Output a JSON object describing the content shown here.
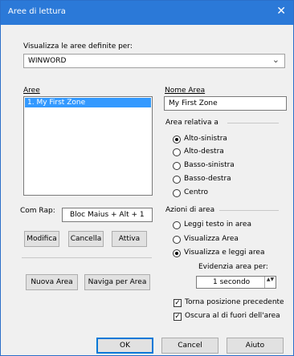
{
  "window": {
    "title": "Aree di lettura",
    "close_glyph": "✕"
  },
  "define_for": {
    "label": "Visualizza le aree definite per:",
    "value": "WINWORD",
    "chevron": "⌄"
  },
  "areas": {
    "label": "Aree",
    "items": [
      "1. My First Zone"
    ]
  },
  "area_name": {
    "label": "Nome Area",
    "value": "My First Zone"
  },
  "relative": {
    "label": "Area relativa a",
    "options": [
      "Alto-sinistra",
      "Alto-destra",
      "Basso-sinistra",
      "Basso-destra",
      "Centro"
    ],
    "selected": "Alto-sinistra"
  },
  "hotkey": {
    "label": "Com Rap:",
    "value": "Bloc Maius + Alt + 1"
  },
  "area_buttons": {
    "modify": "Modifica",
    "delete": "Cancella",
    "activate": "Attiva"
  },
  "bottom_left": {
    "new_area": "Nuova Area",
    "navigate": "Naviga per Area"
  },
  "actions": {
    "label": "Azioni di area",
    "options": [
      "Leggi testo in area",
      "Visualizza Area",
      "Visualizza e leggi area"
    ],
    "selected": "Visualizza e leggi area"
  },
  "highlight": {
    "label": "Evidenzia area per:",
    "value": "1 secondo",
    "spin_glyph": "▲▼"
  },
  "checkboxes": [
    {
      "label": "Torna posizione precedente",
      "checked": true
    },
    {
      "label": "Oscura al di fuori dell'area",
      "checked": true
    }
  ],
  "dialog_buttons": {
    "ok": "OK",
    "cancel": "Cancel",
    "help": "Aiuto"
  },
  "colors": {
    "titlebar": "#2b79d8",
    "selection": "#3399ff",
    "dialog_bg": "#f0f0f0"
  }
}
